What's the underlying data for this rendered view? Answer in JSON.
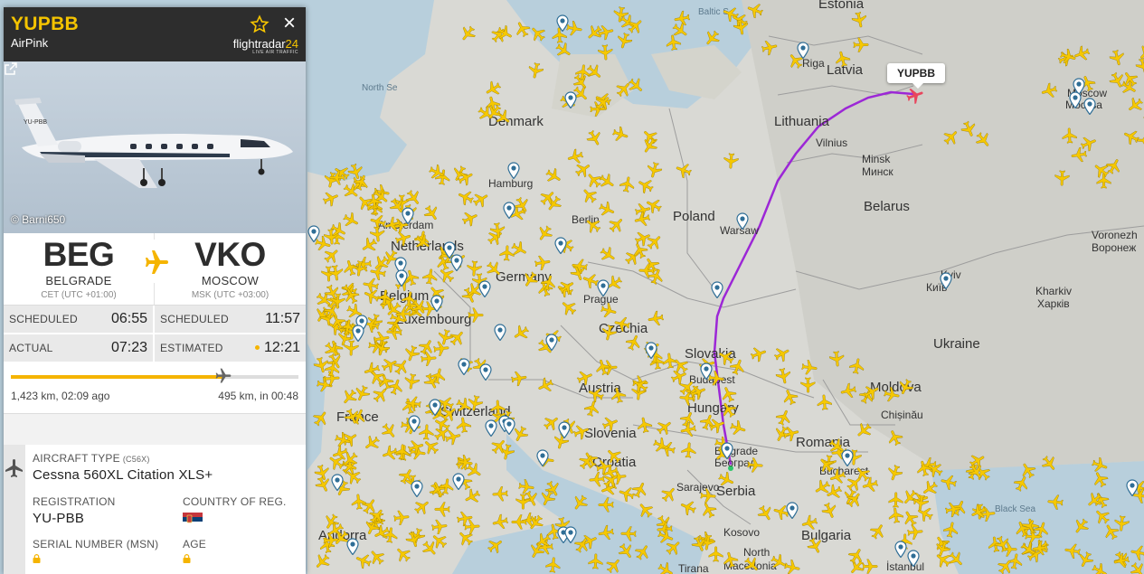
{
  "flight": {
    "id": "YUPBB",
    "airline": "AirPink",
    "callsign_tag": "YUPBB"
  },
  "brand": {
    "name_a": "flightradar",
    "name_b": "24",
    "tagline": "LIVE AIR TRAFFIC"
  },
  "photo": {
    "credit": "© Barni650",
    "registration_on_photo": "YU-PBB"
  },
  "route": {
    "origin": {
      "iata": "BEG",
      "city": "BELGRADE",
      "tz": "CET (UTC +01:00)"
    },
    "destination": {
      "iata": "VKO",
      "city": "MOSCOW",
      "tz": "MSK (UTC +03:00)"
    }
  },
  "times": {
    "scheduled_dep_label": "SCHEDULED",
    "scheduled_dep": "06:55",
    "scheduled_arr_label": "SCHEDULED",
    "scheduled_arr": "11:57",
    "actual_dep_label": "ACTUAL",
    "actual_dep": "07:23",
    "estimated_arr_label": "ESTIMATED",
    "estimated_arr": "12:21"
  },
  "progress": {
    "fraction": 0.74,
    "done_text": "1,423 km, 02:09 ago",
    "left_text": "495 km, in 00:48"
  },
  "aircraft": {
    "type_label": "AIRCRAFT TYPE",
    "type_code": "(C56X)",
    "type_name": "Cessna 560XL Citation XLS+",
    "registration_label": "REGISTRATION",
    "registration": "YU-PBB",
    "country_label": "COUNTRY OF REG.",
    "serial_label": "SERIAL NUMBER (MSN)",
    "age_label": "AGE"
  },
  "map_labels": {
    "estonia": "Estonia",
    "baltic": "Baltic S",
    "north_sea": "North Se",
    "latvia": "Latvia",
    "riga": "Riga",
    "lithuania": "Lithuania",
    "vilnius": "Vilnius",
    "minsk": "Minsk",
    "minsk_ru": "Минск",
    "belarus": "Belarus",
    "moscow": "Moscow",
    "moscow_ru": "Москва",
    "denmark": "Denmark",
    "hamburg": "Hamburg",
    "berlin": "Berlin",
    "poland": "Poland",
    "warsaw": "Warsaw",
    "amsterdam": "Amsterdam",
    "netherlands": "Netherlands",
    "germany": "Germany",
    "belgium": "Belgium",
    "luxembourg": "Luxembourg",
    "prague": "Prague",
    "czechia": "Czechia",
    "slovakia": "Slovakia",
    "austria": "Austria",
    "budapest": "Budapest",
    "hungary": "Hungary",
    "switzerland": "Switzerland",
    "france": "France",
    "slovenia": "Slovenia",
    "croatia": "Croatia",
    "belgrade": "Belgrade",
    "belgrade_sr": "Београд",
    "sarajevo": "Sarajevo",
    "serbia": "Serbia",
    "kosovo": "Kosovo",
    "bulgaria": "Bulgaria",
    "romania": "Romania",
    "bucharest": "Bucharest",
    "moldova": "Moldova",
    "chisinau": "Chișinău",
    "ukraine": "Ukraine",
    "kyiv": "Kyiv",
    "kyiv_uk": "Київ",
    "kharkiv": "Kharkiv",
    "kharkiv_uk": "Харків",
    "voronezh": "Voronezh",
    "voronezh_ru": "Воронеж",
    "black_sea": "Black Sea",
    "andorra": "Andorra",
    "north_mac": "North",
    "macedonia": "Macedonia",
    "tirana": "Tirana",
    "istanbul": "İstanbul"
  },
  "colors": {
    "accent": "#f5c400",
    "track": "#9c27d6",
    "header": "#2d2d2d"
  }
}
